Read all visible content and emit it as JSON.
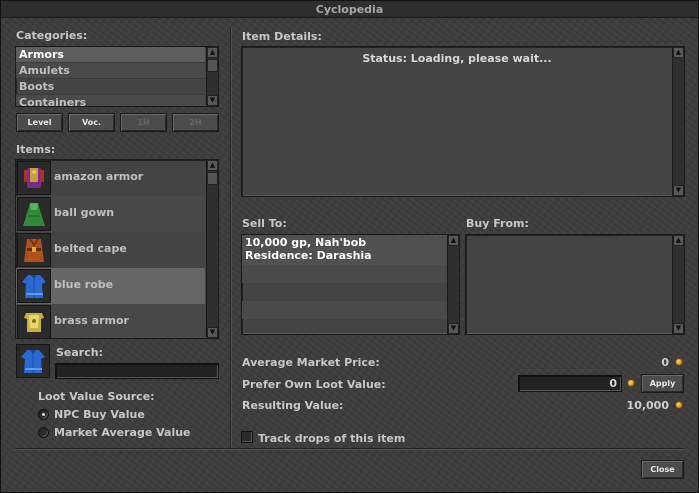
{
  "window": {
    "title": "Cyclopedia"
  },
  "categories": {
    "label": "Categories:",
    "items": [
      "Armors",
      "Amulets",
      "Boots",
      "Containers"
    ],
    "selected": "Armors"
  },
  "filters": {
    "level": "Level",
    "voc": "Voc.",
    "one_hand": "1H",
    "two_hand": "2H"
  },
  "items": {
    "label": "Items:",
    "list": [
      {
        "name": "amazon armor",
        "icon": "amazon-armor-icon"
      },
      {
        "name": "ball gown",
        "icon": "ball-gown-icon"
      },
      {
        "name": "belted cape",
        "icon": "belted-cape-icon"
      },
      {
        "name": "blue robe",
        "icon": "blue-robe-icon"
      },
      {
        "name": "brass armor",
        "icon": "brass-armor-icon"
      }
    ],
    "selected": "blue robe"
  },
  "search": {
    "label": "Search:",
    "value": ""
  },
  "loot_value_source": {
    "label": "Loot Value Source:",
    "npc_buy": "NPC Buy Value",
    "market_average": "Market Average Value",
    "selected": "NPC Buy Value"
  },
  "details": {
    "label": "Item Details:",
    "status": "Status:  Loading, please wait..."
  },
  "sell_to": {
    "label": "Sell To:",
    "entries": [
      {
        "line1": "10,000 gp, Nah'bob",
        "line2": "Residence: Darashia"
      }
    ]
  },
  "buy_from": {
    "label": "Buy From:"
  },
  "pricing": {
    "average_market_label": "Average Market Price:",
    "average_market_value": "0",
    "prefer_own_label": "Prefer Own Loot Value:",
    "prefer_own_value": "0",
    "apply_label": "Apply",
    "resulting_label": "Resulting Value:",
    "resulting_value": "10,000"
  },
  "track_drops": {
    "label": "Track drops of this item",
    "checked": false
  },
  "close_label": "Close",
  "colors": {
    "panel": "#3d3d3d",
    "coin": "#e0a030",
    "selection": "#666666"
  }
}
